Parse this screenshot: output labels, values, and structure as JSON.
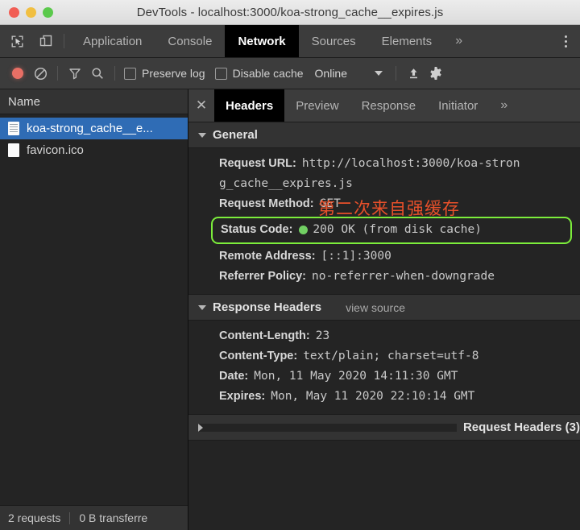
{
  "window": {
    "title": "DevTools - localhost:3000/koa-strong_cache__expires.js",
    "traffic_lights": [
      "close",
      "minimize",
      "zoom"
    ],
    "colors": {
      "close": "#f15e55",
      "minimize": "#f1bf41",
      "zoom": "#5bc94c"
    }
  },
  "main_tabs": {
    "items": [
      {
        "label": "Application",
        "active": false
      },
      {
        "label": "Console",
        "active": false
      },
      {
        "label": "Network",
        "active": true
      },
      {
        "label": "Sources",
        "active": false
      },
      {
        "label": "Elements",
        "active": false
      }
    ],
    "more_label": "»",
    "inspect_icon": "inspect-element-icon",
    "device_icon": "device-toolbar-icon",
    "menu_icon": "kebab-menu-icon"
  },
  "network_toolbar": {
    "record_icon": "record-icon",
    "record_active": true,
    "record_color": "#e86f65",
    "clear_icon": "clear-icon",
    "filter_icon": "filter-icon",
    "search_icon": "search-icon",
    "preserve_log": {
      "label": "Preserve log",
      "checked": false
    },
    "disable_cache": {
      "label": "Disable cache",
      "checked": false
    },
    "throttling": {
      "value": "Online",
      "caret": "chevron-down-icon"
    },
    "import_icon": "import-har-icon",
    "settings_icon": "gear-icon"
  },
  "request_list": {
    "column_header": "Name",
    "rows": [
      {
        "name": "koa-strong_cache__e...",
        "icon": "document-icon",
        "selected": true
      },
      {
        "name": "favicon.ico",
        "icon": "file-icon",
        "selected": false
      }
    ]
  },
  "status_bar": {
    "requests": "2 requests",
    "transferred": "0 B transferre"
  },
  "details_tabs": {
    "close_icon": "close-icon",
    "items": [
      {
        "label": "Headers",
        "active": true
      },
      {
        "label": "Preview",
        "active": false
      },
      {
        "label": "Response",
        "active": false
      },
      {
        "label": "Initiator",
        "active": false
      }
    ],
    "more_label": "»"
  },
  "general": {
    "title": "General",
    "expanded": true,
    "request_url_key": "Request URL:",
    "request_url_line1": "http://localhost:3000/koa-stron",
    "request_url_line2": "g_cache__expires.js",
    "request_method_key": "Request Method:",
    "request_method_value": "GET",
    "status_code_key": "Status Code:",
    "status_code_value": "200 OK (from disk cache)",
    "status_dot_color": "#72d063",
    "highlight_color": "#7ced3b",
    "remote_address_key": "Remote Address:",
    "remote_address_value": "[::1]:3000",
    "referrer_policy_key": "Referrer Policy:",
    "referrer_policy_value": "no-referrer-when-downgrade"
  },
  "annotation": {
    "text": "第二次来自强缓存",
    "color": "#e8502a"
  },
  "response_headers": {
    "title": "Response Headers",
    "view_source": "view source",
    "expanded": true,
    "rows": [
      {
        "key": "Content-Length:",
        "value": "23"
      },
      {
        "key": "Content-Type:",
        "value": "text/plain; charset=utf-8"
      },
      {
        "key": "Date:",
        "value": "Mon, 11 May 2020 14:11:30 GMT"
      },
      {
        "key": "Expires:",
        "value": "Mon, May 11 2020 22:10:14 GMT"
      }
    ]
  },
  "request_headers": {
    "title": "Request Headers (3)",
    "expanded": false
  }
}
